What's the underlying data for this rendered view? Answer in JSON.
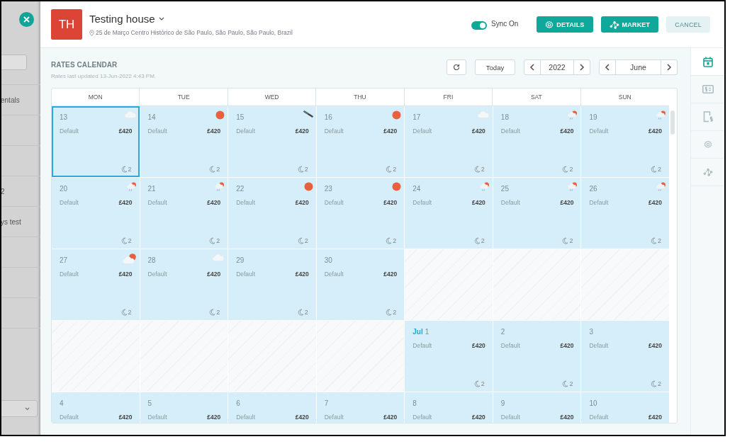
{
  "background_panel": {
    "rows": [
      "entals",
      "2",
      "ys test"
    ]
  },
  "header": {
    "avatar": "TH",
    "title": "Testing house",
    "address": "25 de Março Centro Histórico de São Paulo, São Paulo, São Paulo, Brazil",
    "sync": {
      "label": "Sync On",
      "on": true
    },
    "buttons": [
      {
        "label": "DETAILS",
        "kind": "primary"
      },
      {
        "label": "MARKET",
        "kind": "primary"
      },
      {
        "label": "CANCEL",
        "kind": "secondary"
      }
    ]
  },
  "calendar": {
    "title": "RATES CALENDAR",
    "updated": "Rates last updated 13-Jun-2022 4:43 PM.",
    "today": "Today",
    "year": "2022",
    "month": "June",
    "weekdays": [
      "MON",
      "TUE",
      "WED",
      "THU",
      "FRI",
      "SAT",
      "SUN"
    ],
    "weeks": [
      [
        {
          "kind": "day",
          "date": "13",
          "weather": {
            "kind": "cloud"
          },
          "label": "Default",
          "price": "£420",
          "nights": "2",
          "selected": true
        },
        {
          "kind": "day",
          "date": "14",
          "weather": {
            "kind": "sun"
          },
          "label": "Default",
          "price": "£420",
          "nights": "2",
          "selected": false
        },
        {
          "kind": "day",
          "date": "15",
          "weather": {
            "kind": "streak"
          },
          "label": "Default",
          "price": "£420",
          "nights": "2",
          "selected": false
        },
        {
          "kind": "day",
          "date": "16",
          "weather": {
            "kind": "sun"
          },
          "label": "Default",
          "price": "£420",
          "nights": "2",
          "selected": false
        },
        {
          "kind": "day",
          "date": "17",
          "weather": {
            "kind": "cloud"
          },
          "label": "Default",
          "price": "£420",
          "nights": "2",
          "selected": false
        },
        {
          "kind": "day",
          "date": "18",
          "weather": {
            "kind": "rain"
          },
          "label": "Default",
          "price": "£420",
          "nights": "2",
          "selected": false
        },
        {
          "kind": "day",
          "date": "19",
          "weather": {
            "kind": "rain"
          },
          "label": "Default",
          "price": "£420",
          "nights": "2",
          "selected": false
        }
      ],
      [
        {
          "kind": "day",
          "date": "20",
          "weather": {
            "kind": "rain"
          },
          "label": "Default",
          "price": "£420",
          "nights": "2",
          "selected": false
        },
        {
          "kind": "day",
          "date": "21",
          "weather": {
            "kind": "rain"
          },
          "label": "Default",
          "price": "£420",
          "nights": "2",
          "selected": false
        },
        {
          "kind": "day",
          "date": "22",
          "weather": {
            "kind": "sun"
          },
          "label": "Default",
          "price": "£420",
          "nights": "2",
          "selected": false
        },
        {
          "kind": "day",
          "date": "23",
          "weather": {
            "kind": "sun"
          },
          "label": "Default",
          "price": "£420",
          "nights": "2",
          "selected": false
        },
        {
          "kind": "day",
          "date": "24",
          "weather": {
            "kind": "rain"
          },
          "label": "Default",
          "price": "£420",
          "nights": "2",
          "selected": false
        },
        {
          "kind": "day",
          "date": "25",
          "weather": {
            "kind": "rain"
          },
          "label": "Default",
          "price": "£420",
          "nights": "2",
          "selected": false
        },
        {
          "kind": "day",
          "date": "26",
          "weather": {
            "kind": "rain"
          },
          "label": "Default",
          "price": "£420",
          "nights": "2",
          "selected": false
        }
      ],
      [
        {
          "kind": "day",
          "date": "27",
          "weather": {
            "kind": "sun-cloud"
          },
          "label": "Default",
          "price": "£420",
          "nights": "2",
          "selected": false
        },
        {
          "kind": "day",
          "date": "28",
          "weather": {
            "kind": "cloud"
          },
          "label": "Default",
          "price": "£420",
          "nights": "2",
          "selected": false
        },
        {
          "kind": "day",
          "date": "29",
          "label": "Default",
          "price": "£420",
          "nights": "2",
          "selected": false
        },
        {
          "kind": "day",
          "date": "30",
          "label": "Default",
          "price": "£420",
          "nights": "2",
          "selected": false
        },
        {
          "kind": "empty"
        },
        {
          "kind": "empty"
        },
        {
          "kind": "empty"
        }
      ],
      [
        {
          "kind": "empty"
        },
        {
          "kind": "empty"
        },
        {
          "kind": "empty"
        },
        {
          "kind": "empty"
        },
        {
          "kind": "day",
          "month": "Jul",
          "date": "1",
          "label": "Default",
          "price": "£420",
          "nights": "2",
          "selected": false
        },
        {
          "kind": "day",
          "date": "2",
          "label": "Default",
          "price": "£420",
          "nights": "2",
          "selected": false
        },
        {
          "kind": "day",
          "date": "3",
          "label": "Default",
          "price": "£420",
          "nights": "2",
          "selected": false
        }
      ],
      [
        {
          "kind": "day",
          "date": "4",
          "label": "Default",
          "price": "£420",
          "selected": false
        },
        {
          "kind": "day",
          "date": "5",
          "label": "Default",
          "price": "£420",
          "selected": false
        },
        {
          "kind": "day",
          "date": "6",
          "label": "Default",
          "price": "£420",
          "selected": false
        },
        {
          "kind": "day",
          "date": "7",
          "label": "Default",
          "price": "£420",
          "selected": false
        },
        {
          "kind": "day",
          "date": "8",
          "label": "Default",
          "price": "£420",
          "selected": false
        },
        {
          "kind": "day",
          "date": "9",
          "label": "Default",
          "price": "£420",
          "selected": false
        },
        {
          "kind": "day",
          "date": "10",
          "label": "Default",
          "price": "£420",
          "selected": false
        }
      ]
    ]
  },
  "side_nav": [
    {
      "selected": true
    },
    {
      "selected": false
    },
    {
      "selected": false
    },
    {
      "selected": false
    },
    {
      "selected": false
    }
  ]
}
